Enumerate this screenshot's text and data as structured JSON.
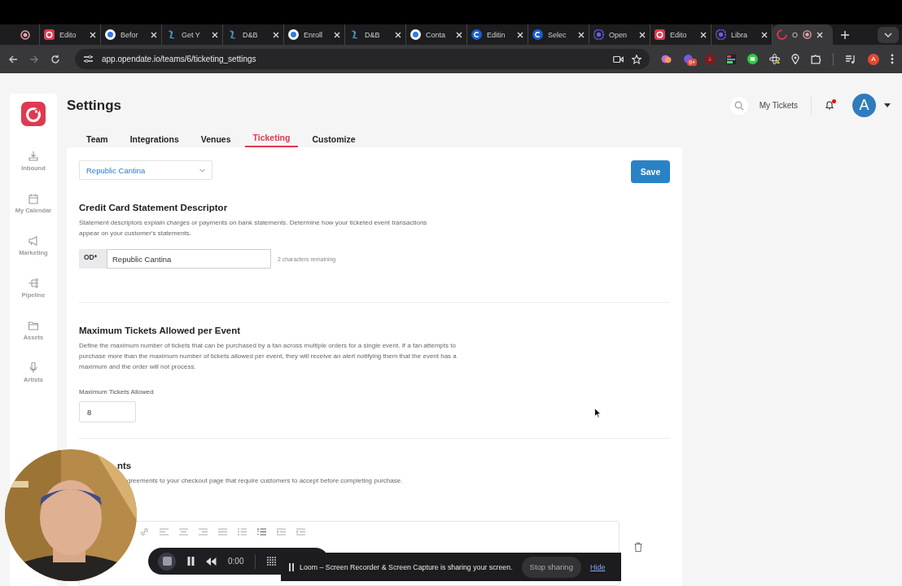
{
  "browser": {
    "tabs": [
      {
        "kind": "record",
        "selected": false
      },
      {
        "kind": "opendate",
        "title": "Edito",
        "selected": false
      },
      {
        "kind": "bluedot",
        "title": "Befor",
        "selected": false
      },
      {
        "kind": "dnb",
        "title": "Get Y",
        "selected": false
      },
      {
        "kind": "dnb",
        "title": "D&B",
        "selected": false
      },
      {
        "kind": "bluedot",
        "title": "Enroll",
        "selected": false
      },
      {
        "kind": "dnb",
        "title": "D&B",
        "selected": false
      },
      {
        "kind": "bluedot",
        "title": "Conta",
        "selected": false
      },
      {
        "kind": "cblue",
        "title": "Editin",
        "selected": false
      },
      {
        "kind": "cblue",
        "title": "Selec",
        "selected": false
      },
      {
        "kind": "flower",
        "title": "Open",
        "selected": false
      },
      {
        "kind": "opendate",
        "title": "Edito",
        "selected": false
      },
      {
        "kind": "flower",
        "title": "Libra",
        "selected": false
      },
      {
        "kind": "loading",
        "title": "O",
        "selected": true
      }
    ],
    "url": "app.opendate.io/teams/6/ticketing_settings",
    "extension_badge": "9+",
    "profile_letter": "A"
  },
  "sidebar": {
    "items": [
      {
        "kind": "inbound",
        "label": "Inbound"
      },
      {
        "kind": "calendar",
        "label": "My Calendar"
      },
      {
        "kind": "megaphone",
        "label": "Marketing"
      },
      {
        "kind": "pipeline",
        "label": "Pipeline"
      },
      {
        "kind": "folder",
        "label": "Assets"
      },
      {
        "kind": "mic",
        "label": "Artists"
      }
    ]
  },
  "header": {
    "title": "Settings",
    "my_tickets": "My Tickets",
    "notification_dot": true,
    "avatar_letter": "A"
  },
  "tabs": [
    {
      "label": "Team",
      "selected": false
    },
    {
      "label": "Integrations",
      "selected": false
    },
    {
      "label": "Venues",
      "selected": false
    },
    {
      "label": "Ticketing",
      "selected": true
    },
    {
      "label": "Customize",
      "selected": false
    }
  ],
  "venue_select": {
    "value": "Republic Cantina"
  },
  "save_button": "Save",
  "descriptor": {
    "heading": "Credit Card Statement Descriptor",
    "description": "Statement descriptors explain charges or payments on bank statements. Determine how your ticketed event transactions appear on your customer's statements.",
    "prefix": "OD*",
    "value": "Republic Cantina",
    "remaining": "2 characters remaining"
  },
  "max_tickets": {
    "heading": "Maximum Tickets Allowed per Event",
    "description": "Define the maximum number of tickets that can be purchased by a fan across multiple orders for a single event. If a fan attempts to purchase more than the maximum number of tickets allowed per event, they will receive an alert notifying them that the event has a maximum and the order will not process.",
    "label": "Maximum Tickets Allowed",
    "value": "8"
  },
  "agreements": {
    "heading": "nts",
    "description": "greements to your checkout page that require customers to accept before completing purchase."
  },
  "recorder": {
    "time": "0:00",
    "banner": "Loom – Screen Recorder & Screen Capture is sharing your screen.",
    "stop_button": "Stop sharing",
    "hide_link": "Hide"
  }
}
